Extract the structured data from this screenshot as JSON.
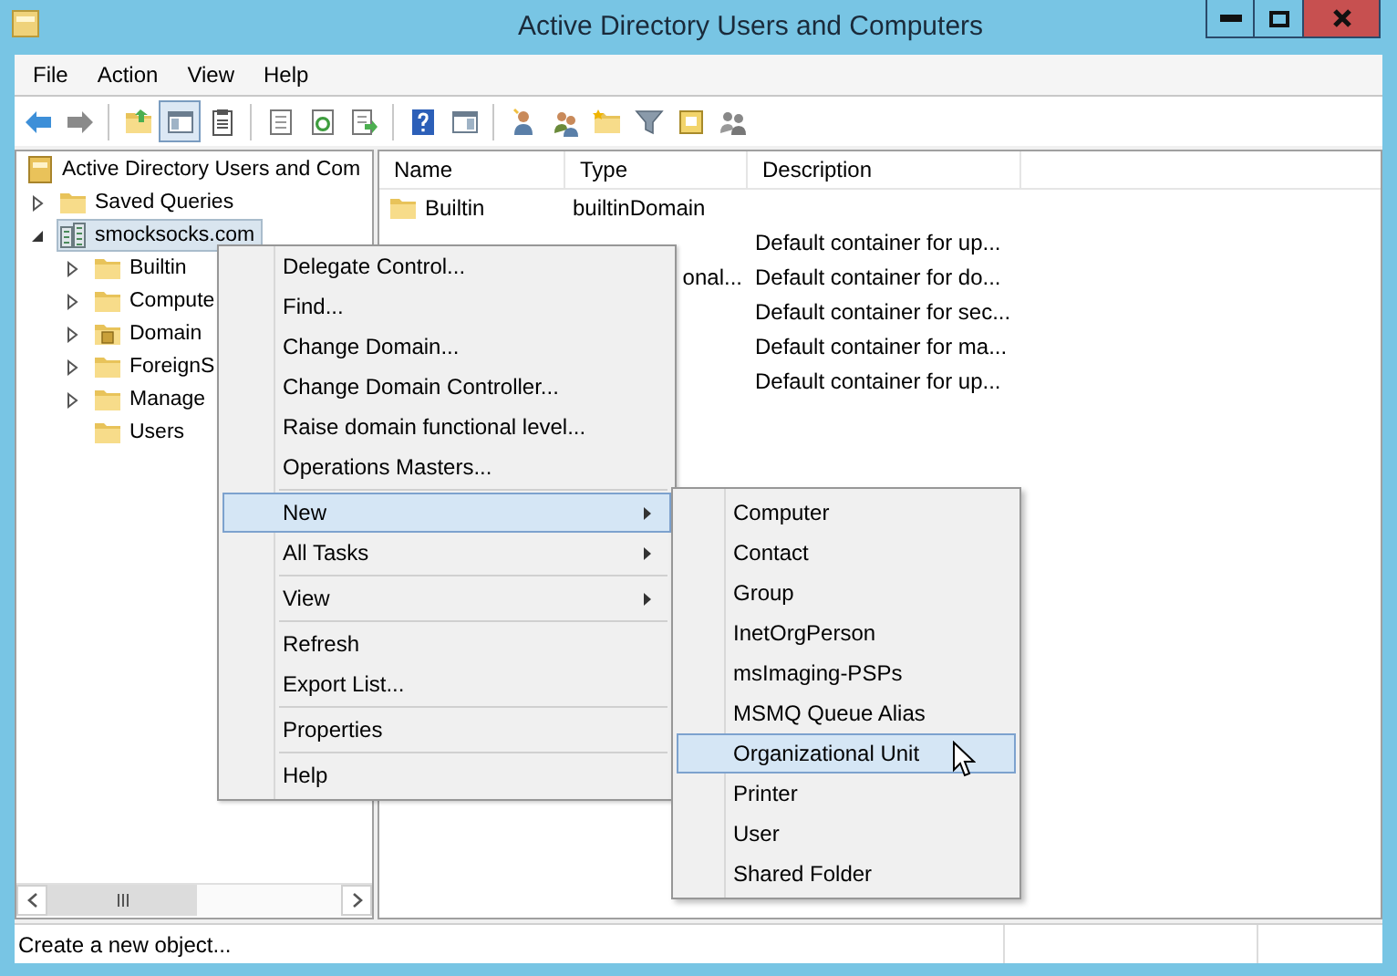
{
  "window": {
    "title": "Active Directory Users and Computers"
  },
  "menu_bar": [
    "File",
    "Action",
    "View",
    "Help"
  ],
  "toolbar": [
    {
      "kind": "back",
      "pressed": false
    },
    {
      "kind": "forward",
      "pressed": false
    },
    {
      "kind": "separator"
    },
    {
      "kind": "folder-up",
      "pressed": false
    },
    {
      "kind": "pane",
      "pressed": true
    },
    {
      "kind": "clipboard",
      "pressed": false
    },
    {
      "kind": "separator"
    },
    {
      "kind": "doc",
      "pressed": false
    },
    {
      "kind": "refresh",
      "pressed": false
    },
    {
      "kind": "export",
      "pressed": false
    },
    {
      "kind": "separator"
    },
    {
      "kind": "help",
      "pressed": false
    },
    {
      "kind": "pane2",
      "pressed": false
    },
    {
      "kind": "separator"
    },
    {
      "kind": "user",
      "pressed": false
    },
    {
      "kind": "users",
      "pressed": false
    },
    {
      "kind": "folder-star",
      "pressed": false
    },
    {
      "kind": "filter",
      "pressed": false
    },
    {
      "kind": "note",
      "pressed": false
    },
    {
      "kind": "group",
      "pressed": false
    }
  ],
  "tree": {
    "items": [
      {
        "label": "Active Directory Users and Com",
        "kind": "root",
        "selected": false,
        "children": [
          {
            "label": "Saved Queries",
            "kind": "folder",
            "expandable": true,
            "expanded": false,
            "selected": false
          },
          {
            "label": "smocksocks.com",
            "kind": "domain",
            "expandable": true,
            "expanded": true,
            "selected": true,
            "children": [
              {
                "label": "Builtin",
                "kind": "folder",
                "expandable": true,
                "expanded": false,
                "selected": false
              },
              {
                "label": "Compute",
                "kind": "folder",
                "expandable": true,
                "expanded": false,
                "selected": false
              },
              {
                "label": "Domain",
                "kind": "special-folder",
                "expandable": true,
                "expanded": false,
                "selected": false
              },
              {
                "label": "ForeignS",
                "kind": "folder",
                "expandable": true,
                "expanded": false,
                "selected": false
              },
              {
                "label": "Manage",
                "kind": "folder",
                "expandable": true,
                "expanded": false,
                "selected": false
              },
              {
                "label": "Users",
                "kind": "folder",
                "expandable": false,
                "expanded": false,
                "selected": false
              }
            ]
          }
        ]
      }
    ]
  },
  "list": {
    "columns": [
      "Name",
      "Type",
      "Description"
    ],
    "rows": [
      {
        "name": "Builtin",
        "type": "builtinDomain",
        "kind": "folder"
      },
      {
        "description": "Default container for up..."
      },
      {
        "type": "onal...",
        "description": "Default container for do..."
      },
      {
        "description": "Default container for sec..."
      },
      {
        "description": "Default container for ma..."
      },
      {
        "description": "Default container for up..."
      }
    ]
  },
  "context_menu": {
    "items": [
      {
        "kind": "item",
        "label": "Delegate Control...",
        "submenu": false,
        "selected": false
      },
      {
        "kind": "item",
        "label": "Find...",
        "submenu": false,
        "selected": false
      },
      {
        "kind": "item",
        "label": "Change Domain...",
        "submenu": false,
        "selected": false
      },
      {
        "kind": "item",
        "label": "Change Domain Controller...",
        "submenu": false,
        "selected": false
      },
      {
        "kind": "item",
        "label": "Raise domain functional level...",
        "submenu": false,
        "selected": false
      },
      {
        "kind": "item",
        "label": "Operations Masters...",
        "submenu": false,
        "selected": false
      },
      {
        "kind": "separator"
      },
      {
        "kind": "item",
        "label": "New",
        "submenu": true,
        "selected": true
      },
      {
        "kind": "item",
        "label": "All Tasks",
        "submenu": true,
        "selected": false
      },
      {
        "kind": "separator"
      },
      {
        "kind": "item",
        "label": "View",
        "submenu": true,
        "selected": false
      },
      {
        "kind": "separator"
      },
      {
        "kind": "item",
        "label": "Refresh",
        "submenu": false,
        "selected": false
      },
      {
        "kind": "item",
        "label": "Export List...",
        "submenu": false,
        "selected": false
      },
      {
        "kind": "separator"
      },
      {
        "kind": "item",
        "label": "Properties",
        "submenu": false,
        "selected": false
      },
      {
        "kind": "separator"
      },
      {
        "kind": "item",
        "label": "Help",
        "submenu": false,
        "selected": false
      }
    ]
  },
  "submenu": {
    "items": [
      {
        "label": "Computer",
        "selected": false
      },
      {
        "label": "Contact",
        "selected": false
      },
      {
        "label": "Group",
        "selected": false
      },
      {
        "label": "InetOrgPerson",
        "selected": false
      },
      {
        "label": "msImaging-PSPs",
        "selected": false
      },
      {
        "label": "MSMQ Queue Alias",
        "selected": false
      },
      {
        "label": "Organizational Unit",
        "selected": true
      },
      {
        "label": "Printer",
        "selected": false
      },
      {
        "label": "User",
        "selected": false
      },
      {
        "label": "Shared Folder",
        "selected": false
      }
    ]
  },
  "status_bar": {
    "text": "Create a new object..."
  }
}
